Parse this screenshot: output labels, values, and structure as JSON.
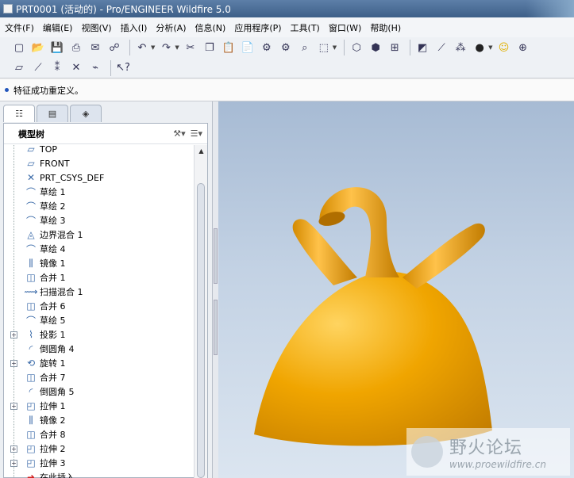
{
  "window": {
    "title": "PRT0001 (活动的) - Pro/ENGINEER Wildfire 5.0"
  },
  "menu": [
    "文件(F)",
    "编辑(E)",
    "视图(V)",
    "插入(I)",
    "分析(A)",
    "信息(N)",
    "应用程序(P)",
    "工具(T)",
    "窗口(W)",
    "帮助(H)"
  ],
  "status": {
    "message": "特征成功重定义。"
  },
  "navigator": {
    "tabs": [
      "model-tree-tab",
      "folder-tab",
      "favorites-tab"
    ],
    "title": "模型树",
    "tree": [
      {
        "label": "TOP",
        "icon": "plane-icon",
        "expandable": false
      },
      {
        "label": "FRONT",
        "icon": "plane-icon",
        "expandable": false
      },
      {
        "label": "PRT_CSYS_DEF",
        "icon": "csys-icon",
        "expandable": false
      },
      {
        "label": "草绘 1",
        "icon": "sketch-icon",
        "expandable": false
      },
      {
        "label": "草绘 2",
        "icon": "sketch-icon",
        "expandable": false
      },
      {
        "label": "草绘 3",
        "icon": "sketch-icon",
        "expandable": false
      },
      {
        "label": "边界混合 1",
        "icon": "boundary-blend-icon",
        "expandable": false
      },
      {
        "label": "草绘 4",
        "icon": "sketch-icon",
        "expandable": false
      },
      {
        "label": "镜像 1",
        "icon": "mirror-icon",
        "expandable": false
      },
      {
        "label": "合并 1",
        "icon": "merge-icon",
        "expandable": false
      },
      {
        "label": "扫描混合 1",
        "icon": "swept-blend-icon",
        "expandable": false
      },
      {
        "label": "合并 6",
        "icon": "merge-icon",
        "expandable": false
      },
      {
        "label": "草绘 5",
        "icon": "sketch-icon",
        "expandable": false
      },
      {
        "label": "投影 1",
        "icon": "projection-icon",
        "expandable": true
      },
      {
        "label": "倒圆角 4",
        "icon": "round-icon",
        "expandable": false
      },
      {
        "label": "旋转 1",
        "icon": "revolve-icon",
        "expandable": true
      },
      {
        "label": "合并 7",
        "icon": "merge-icon",
        "expandable": false
      },
      {
        "label": "倒圆角 5",
        "icon": "round-icon",
        "expandable": false
      },
      {
        "label": "拉伸 1",
        "icon": "extrude-icon",
        "expandable": true
      },
      {
        "label": "镜像 2",
        "icon": "mirror-icon",
        "expandable": false
      },
      {
        "label": "合并 8",
        "icon": "merge-icon",
        "expandable": false
      },
      {
        "label": "拉伸 2",
        "icon": "extrude-icon",
        "expandable": true
      },
      {
        "label": "拉伸 3",
        "icon": "extrude-icon",
        "expandable": true
      },
      {
        "label": "在此插入",
        "icon": "insert-here-icon",
        "expandable": false
      }
    ]
  },
  "watermark": {
    "brand": "野火论坛",
    "url": "www.proewildfire.cn"
  },
  "colors": {
    "model": "#f0a500",
    "viewport_top": "#a7bbd4",
    "viewport_bottom": "#dbe5f0"
  }
}
